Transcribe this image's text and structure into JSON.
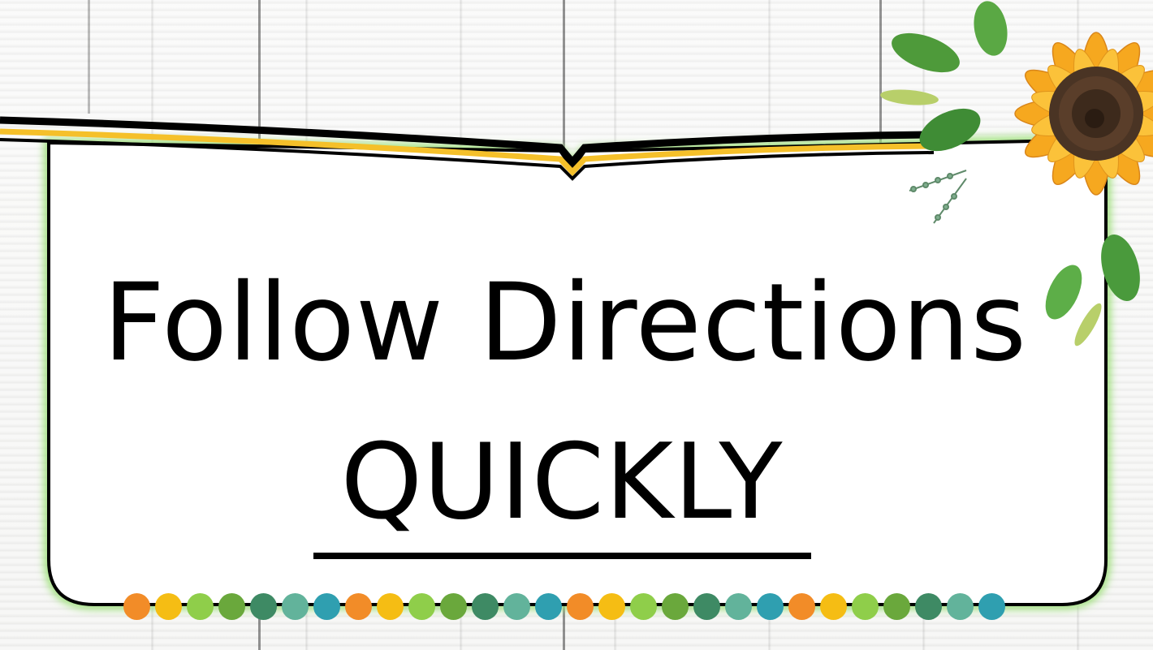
{
  "slide": {
    "title_line_1": "Follow Directions",
    "title_line_2": "QUICKLY"
  },
  "colors": {
    "frame_stroke": "#000000",
    "banner_yellow": "#f5c02a",
    "card_glow": "#9ee07a",
    "dot_sequence": [
      "#f28c28",
      "#f5bd14",
      "#8fce4a",
      "#6aa83c",
      "#3e8a64",
      "#62b39b",
      "#2f9fb0"
    ]
  },
  "decorations": {
    "corner_art_icon": "sunflower-bouquet-icon",
    "dot_count": 28
  }
}
